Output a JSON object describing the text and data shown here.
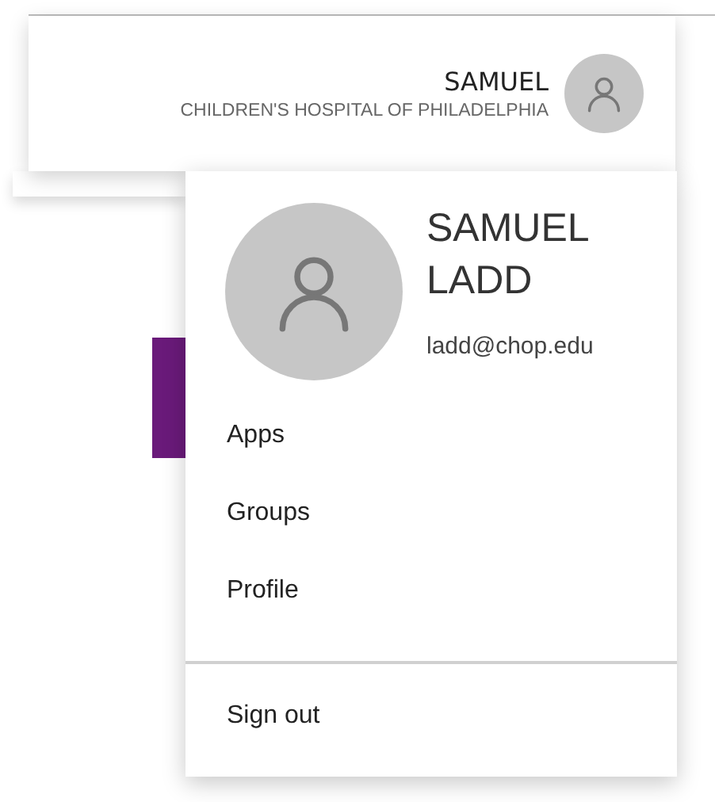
{
  "header": {
    "name": "SAMUEL",
    "organization": "CHILDREN'S HOSPITAL OF PHILADELPHIA"
  },
  "menu": {
    "name": "SAMUEL LADD",
    "email": "ladd@chop.edu",
    "items": [
      {
        "label": "Apps",
        "kind": "link"
      },
      {
        "label": "Groups",
        "kind": "link"
      },
      {
        "label": "Profile",
        "kind": "link"
      },
      {
        "kind": "divider"
      },
      {
        "label": "Sign out",
        "kind": "link"
      }
    ]
  }
}
